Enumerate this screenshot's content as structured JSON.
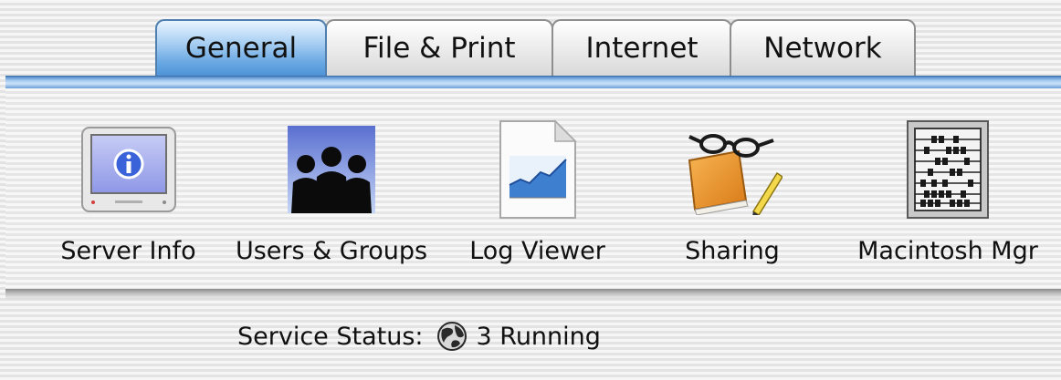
{
  "tabs": [
    {
      "label": "General",
      "active": true
    },
    {
      "label": "File & Print",
      "active": false
    },
    {
      "label": "Internet",
      "active": false
    },
    {
      "label": "Network",
      "active": false
    }
  ],
  "tools": [
    {
      "label": "Server Info",
      "icon": "server-info-icon"
    },
    {
      "label": "Users & Groups",
      "icon": "users-groups-icon"
    },
    {
      "label": "Log Viewer",
      "icon": "log-viewer-icon"
    },
    {
      "label": "Sharing",
      "icon": "sharing-icon"
    },
    {
      "label": "Macintosh Mgr",
      "icon": "macintosh-manager-icon"
    }
  ],
  "status": {
    "label": "Service Status:",
    "value": "3 Running",
    "icon": "globe-icon"
  },
  "colors": {
    "active_tab": "#6aa9e3",
    "tab_border": "#8e8e8e",
    "accent_rule": "#4f88c8"
  }
}
